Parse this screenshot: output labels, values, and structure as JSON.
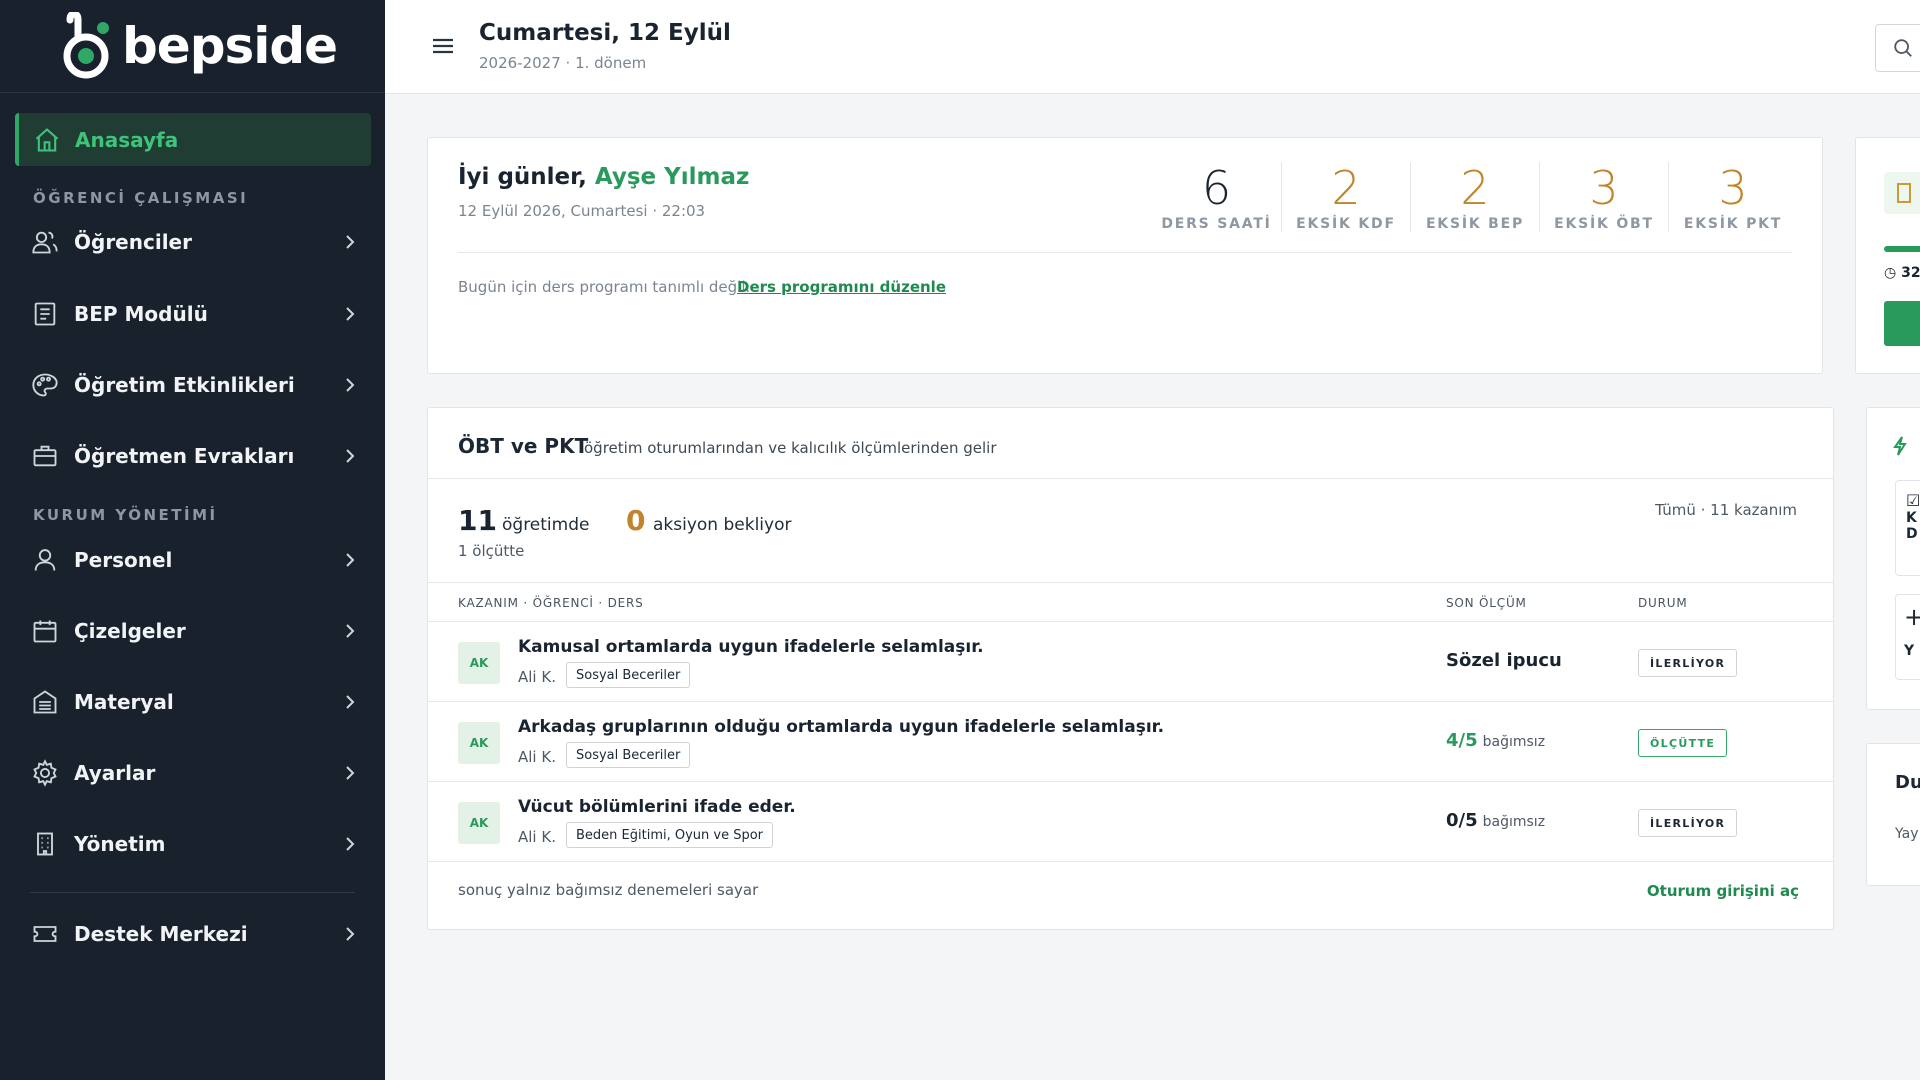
{
  "brand": {
    "name": "bepside"
  },
  "sidebar": {
    "home": {
      "label": "Anasayfa"
    },
    "sections": [
      {
        "title": "ÖĞRENCİ ÇALIŞMASI"
      },
      {
        "title": "KURUM YÖNETİMİ"
      }
    ],
    "items": [
      {
        "label": "Öğrenciler",
        "icon": "users-icon"
      },
      {
        "label": "BEP Modülü",
        "icon": "document-icon"
      },
      {
        "label": "Öğretim Etkinlikleri",
        "icon": "palette-icon"
      },
      {
        "label": "Öğretmen Evrakları",
        "icon": "briefcase-icon"
      },
      {
        "label": "Personel",
        "icon": "user-icon"
      },
      {
        "label": "Çizelgeler",
        "icon": "calendar-icon"
      },
      {
        "label": "Materyal",
        "icon": "archive-icon"
      },
      {
        "label": "Ayarlar",
        "icon": "gear-icon"
      },
      {
        "label": "Yönetim",
        "icon": "building-icon"
      },
      {
        "label": "Destek Merkezi",
        "icon": "ticket-icon"
      }
    ]
  },
  "header": {
    "title": "Cumartesi, 12 Eylül",
    "subtitle": "2026-2027 · 1. dönem"
  },
  "greeting": {
    "prefix": "İyi günler,",
    "name": "Ayşe Yılmaz",
    "datetime": "12 Eylül 2026, Cumartesi · 22:03",
    "no_schedule": "Bugün için ders programı tanımlı değil.",
    "edit_link": "Ders programını düzenle"
  },
  "stats": [
    {
      "value": "6",
      "label": "DERS SAATİ",
      "color": "#1a2430"
    },
    {
      "value": "2",
      "label": "EKSİK KDF",
      "color": "#c0842a"
    },
    {
      "value": "2",
      "label": "EKSİK BEP",
      "color": "#c0842a"
    },
    {
      "value": "3",
      "label": "EKSİK ÖBT",
      "color": "#c0842a"
    },
    {
      "value": "3",
      "label": "EKSİK PKT",
      "color": "#c0842a"
    }
  ],
  "obt": {
    "title": "ÖBT ve PKT",
    "desc": "öğretim oturumlarından ve kalıcılık ölçümlerinden gelir",
    "teaching_count": "11",
    "teaching_label": "öğretimde",
    "action_count": "0",
    "action_label": "aksiyon bekliyor",
    "measure_note": "1 ölçütte",
    "filter": "Tümü · 11 kazanım",
    "columns": {
      "kazanim": "KAZANIM · ÖĞRENCİ · DERS",
      "son": "SON ÖLÇÜM",
      "durum": "DURUM"
    },
    "rows": [
      {
        "avatar": "AK",
        "kazanim": "Kamusal ortamlarda uygun ifadelerle selamlaşır.",
        "student": "Ali K.",
        "course": "Sosyal Beceriler",
        "olcum": "Sözel ipucu",
        "olcum_sub": "",
        "status": "İLERLİYOR"
      },
      {
        "avatar": "AK",
        "kazanim": "Arkadaş gruplarının olduğu ortamlarda uygun ifadelerle selamlaşır.",
        "student": "Ali K.",
        "course": "Sosyal Beceriler",
        "olcum": "4/5",
        "olcum_sub": "bağımsız",
        "status": "ÖLÇÜTTE"
      },
      {
        "avatar": "AK",
        "kazanim": "Vücut bölümlerini ifade eder.",
        "student": "Ali K.",
        "course": "Beden Eğitimi, Oyun ve Spor",
        "olcum": "0/5",
        "olcum_sub": "bağımsız",
        "status": "İLERLİYOR"
      }
    ],
    "footer_note": "sonuç yalnız bağımsız denemeleri sayar",
    "footer_link": "Oturum girişini aç"
  },
  "right_panel": {
    "partial1": "32",
    "partial2_a": "K",
    "partial2_b": "D",
    "partial2_c": "Y",
    "partial3_title": "Du",
    "partial3_sub": "Yay"
  },
  "colors": {
    "sidebar": "#18212c",
    "accent": "#2a9a5c",
    "warning": "#c0842a"
  }
}
